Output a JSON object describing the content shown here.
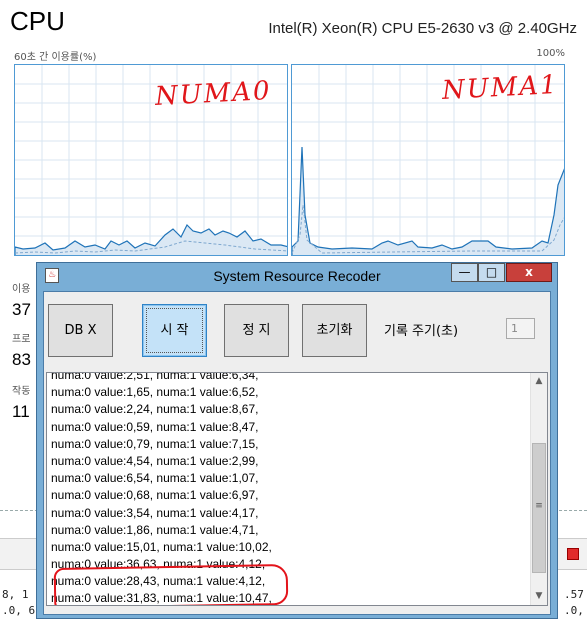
{
  "task_manager": {
    "title": "CPU",
    "cpu_model": "Intel(R) Xeon(R) CPU E5-2630 v3 @ 2.40GHz",
    "graph_label": "60초 간 이용률(%)",
    "graph_max": "100%",
    "graphs": [
      {
        "annotation": "NUMA0",
        "line_color": "#1f73b8",
        "fill_color": "#dbe8f4"
      },
      {
        "annotation": "NUMA1",
        "line_color": "#1f73b8",
        "fill_color": "#dbe8f4"
      }
    ],
    "stats": [
      {
        "label": "이용",
        "value": "37"
      },
      {
        "label": "프로",
        "value": "83"
      },
      {
        "label": "작동",
        "value": "11"
      }
    ],
    "code_fragments": {
      "left_1": "8, 1",
      "left_2": ".0, 6",
      "right_1": ".57",
      "right_2": ".0,"
    }
  },
  "dialog": {
    "title": "System Resource Recoder",
    "title_icon": "java-cup-icon",
    "window_buttons": {
      "minimize": "—",
      "maximize": "□",
      "close": "x"
    },
    "buttons": {
      "db": "DB X",
      "start": "시 작",
      "stop": "정 지",
      "reset": "초기화"
    },
    "period_label": "기록 주기(초)",
    "period_value": "1",
    "log_lines": [
      "numa:0 value:2,51, numa:1 value:6,34,",
      "numa:0 value:1,65, numa:1 value:6,52,",
      "numa:0 value:2,24, numa:1 value:8,67,",
      "numa:0 value:0,59, numa:1 value:8,47,",
      "numa:0 value:0,79, numa:1 value:7,15,",
      "numa:0 value:4,54, numa:1 value:2,99,",
      "numa:0 value:6,54, numa:1 value:1,07,",
      "numa:0 value:0,68, numa:1 value:6,97,",
      "numa:0 value:3,54, numa:1 value:4,17,",
      "numa:0 value:1,86, numa:1 value:4,71,",
      "numa:0 value:15,01, numa:1 value:10,02,",
      "numa:0 value:36,63, numa:1 value:4,12,",
      "numa:0 value:28,43, numa:1 value:4,12,",
      "numa:0 value:31,83, numa:1 value:10,47,"
    ],
    "scrollbar": {
      "up": "▲",
      "down": "▼",
      "grip": "≡"
    }
  },
  "colors": {
    "accent": "#2f83c7",
    "annotation_red": "#e3141b",
    "window_frame": "#79aed6",
    "graph_border": "#4f9ad4"
  }
}
